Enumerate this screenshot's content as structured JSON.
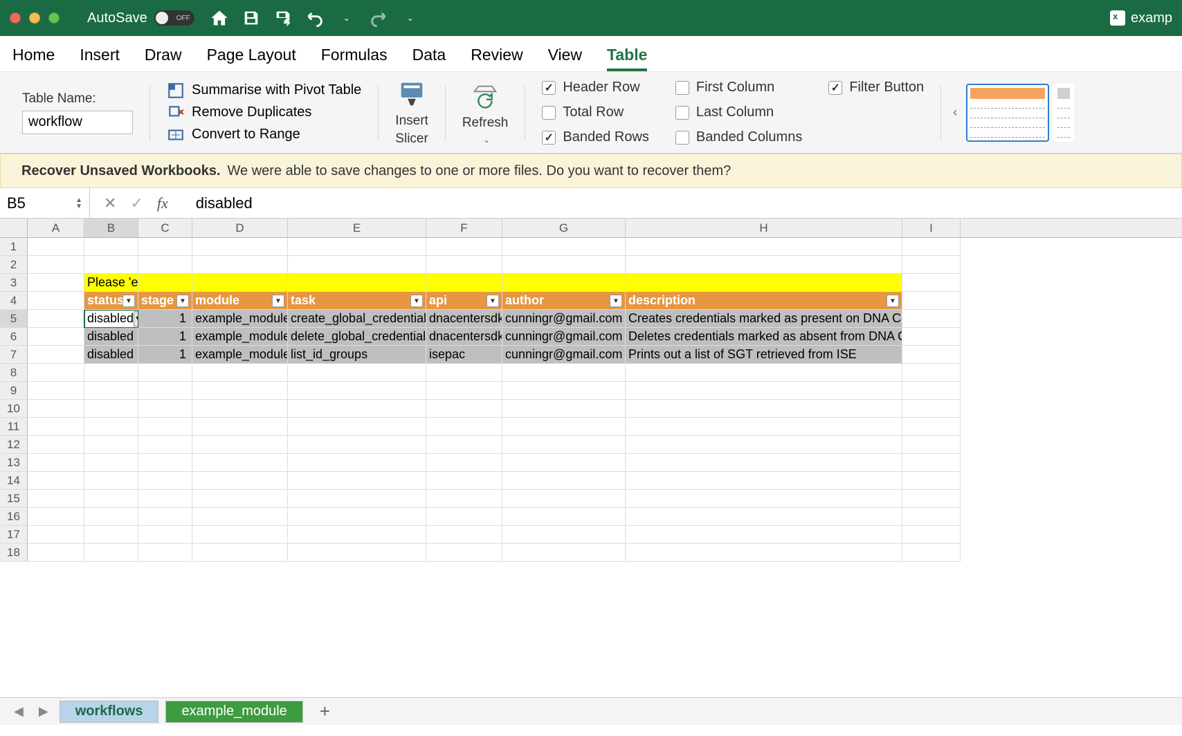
{
  "titlebar": {
    "autosave_label": "AutoSave",
    "autosave_state": "OFF",
    "filename": "examp"
  },
  "ribbon_tabs": [
    "Home",
    "Insert",
    "Draw",
    "Page Layout",
    "Formulas",
    "Data",
    "Review",
    "View",
    "Table"
  ],
  "ribbon_active": "Table",
  "ribbon": {
    "table_name_label": "Table Name:",
    "table_name_value": "workflow",
    "pivot": "Summarise with Pivot Table",
    "dup": "Remove Duplicates",
    "range": "Convert to Range",
    "slicer_l1": "Insert",
    "slicer_l2": "Slicer",
    "refresh": "Refresh",
    "opts": {
      "header_row": "Header Row",
      "total_row": "Total Row",
      "banded_rows": "Banded Rows",
      "first_col": "First Column",
      "last_col": "Last Column",
      "banded_cols": "Banded Columns",
      "filter_btn": "Filter Button"
    }
  },
  "recover": {
    "title": "Recover Unsaved Workbooks.",
    "msg": "We were able to save changes to one or more files. Do you want to recover them?"
  },
  "namebox": "B5",
  "formula_value": "disabled",
  "columns": [
    "A",
    "B",
    "C",
    "D",
    "E",
    "F",
    "G",
    "H",
    "I"
  ],
  "instruction": "Please 'enable' the required workflow tasks in the table below:",
  "headers": [
    "status",
    "stage",
    "module",
    "task",
    "api",
    "author",
    "description"
  ],
  "rows": [
    {
      "status": "disabled",
      "stage": "1",
      "module": "example_module",
      "task": "create_global_credentials",
      "api": "dnacentersdk",
      "author": "cunningr@gmail.com",
      "description": "Creates credentials marked as present on DNA Center"
    },
    {
      "status": "disabled",
      "stage": "1",
      "module": "example_module",
      "task": "delete_global_credentials",
      "api": "dnacentersdk",
      "author": "cunningr@gmail.com",
      "description": "Deletes credentials marked as absent from DNA Center"
    },
    {
      "status": "disabled",
      "stage": "1",
      "module": "example_module",
      "task": "list_id_groups",
      "api": "isepac",
      "author": "cunningr@gmail.com",
      "description": "Prints out a list of SGT retrieved from ISE"
    }
  ],
  "sheets": {
    "workflows": "workflows",
    "module": "example_module"
  }
}
